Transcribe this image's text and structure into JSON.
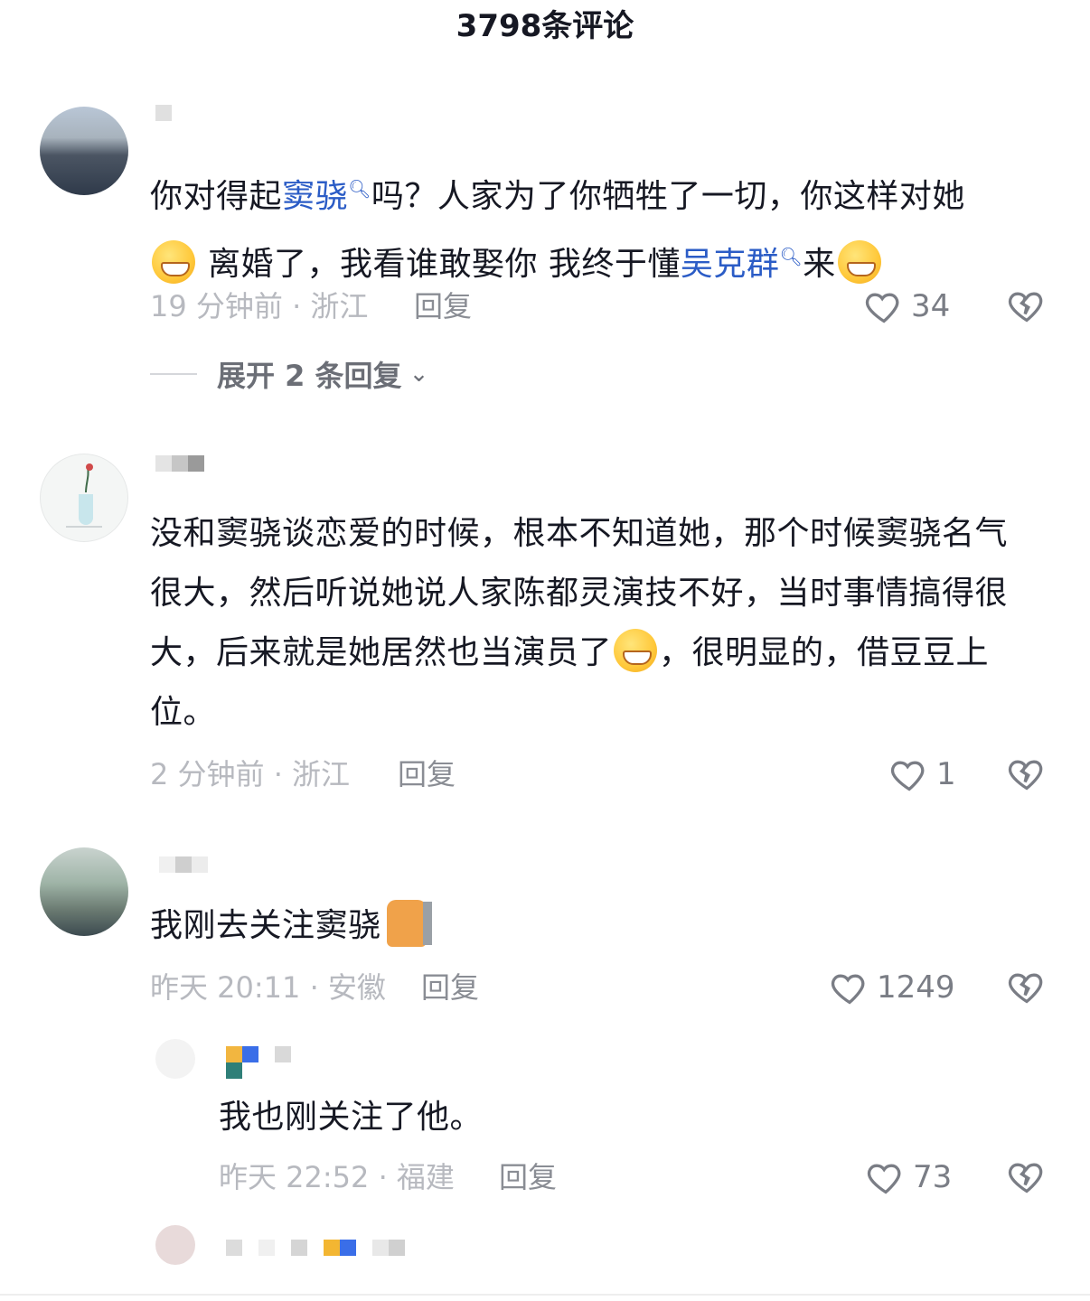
{
  "header": {
    "title": "3798条评论"
  },
  "comments": [
    {
      "text_parts": [
        "你对得起",
        "窦骁",
        "吗？人家为了你牺牲了一切，你这样对她",
        " 离婚了，我看谁敢娶你 我终于懂",
        "吴克群",
        "来"
      ],
      "time": "19 分钟前 · 浙江",
      "reply": "回复",
      "likes": "34",
      "expand": "展开 2 条回复"
    },
    {
      "text_before": "没和窦骁谈恋爱的时候，根本不知道她，那个时候窦骁名气很大，然后听说她说人家陈都灵演技不好，当时事情搞得很大，后来就是她居然也当演员了",
      "text_after": "，很明显的，借豆豆上位。",
      "time": "2 分钟前 · 浙江",
      "reply": "回复",
      "likes": "1"
    },
    {
      "text": "我刚去关注窦骁",
      "time": "昨天 20:11 · 安徽",
      "reply": "回复",
      "likes": "1249"
    },
    {
      "text": "我也刚关注了他。",
      "time": "昨天 22:52 · 福建",
      "reply": "回复",
      "likes": "73"
    }
  ],
  "icons": {
    "like": "heart-outline-icon",
    "dislike": "broken-heart-icon",
    "search": "search-icon",
    "expand": "chevron-down-icon"
  },
  "colors": {
    "link": "#2b5cc6",
    "meta": "#a0a3ab",
    "text": "#161823"
  }
}
